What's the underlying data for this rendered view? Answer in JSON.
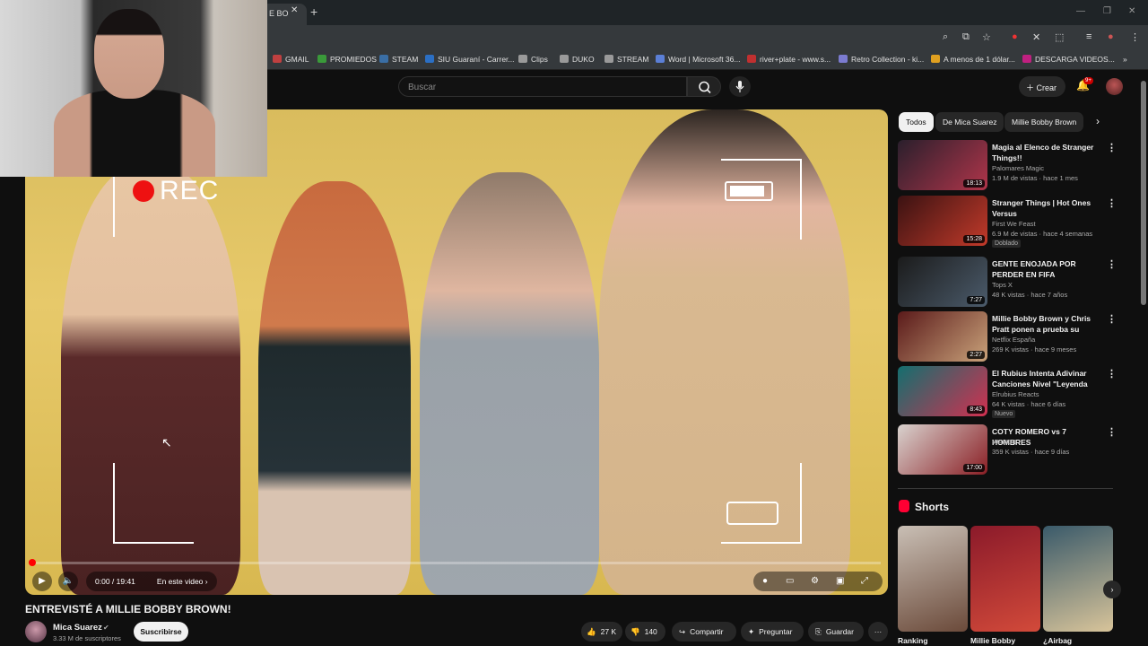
{
  "browser": {
    "tab_title": "E BO",
    "bookmarks": [
      {
        "label": "GMAIL",
        "color": "#c04040"
      },
      {
        "label": "PROMIEDOS",
        "color": "#3a9a3a"
      },
      {
        "label": "STEAM",
        "color": "#3a6ea5"
      },
      {
        "label": "SIU Guaraní - Carrer...",
        "color": "#2b6fc4"
      },
      {
        "label": "Clips",
        "color": "#9a9a9a"
      },
      {
        "label": "DUKO",
        "color": "#9a9a9a"
      },
      {
        "label": "STREAM",
        "color": "#9a9a9a"
      },
      {
        "label": "Word | Microsoft 36...",
        "color": "#5b7fd6"
      },
      {
        "label": "river+plate - www.s...",
        "color": "#c03030"
      },
      {
        "label": "Retro Collection - ki...",
        "color": "#7b7bd0"
      },
      {
        "label": "A menos de 1 dólar...",
        "color": "#e0a020"
      },
      {
        "label": "DESCARGA VIDEOS...",
        "color": "#c02080"
      }
    ]
  },
  "header": {
    "search_placeholder": "Buscar",
    "create_label": "Crear",
    "notif_count": "9+"
  },
  "player": {
    "overlay_rec": "REC",
    "time": "0:00 / 19:41",
    "chapter": "En este video ›",
    "progress": 0.0
  },
  "video": {
    "title": "ENTREVISTÉ A MILLIE BOBBY BROWN!",
    "channel": "Mica Suarez",
    "subscribers": "3.33 M de suscriptores",
    "subscribe_label": "Suscribirse",
    "likes": "27 K",
    "dislikes": "140",
    "share_label": "Compartir",
    "ask_label": "Preguntar",
    "save_label": "Guardar",
    "more_label": "···"
  },
  "sidebar": {
    "chips": [
      "Todos",
      "De Mica Suarez",
      "Millie Bobby Brown"
    ],
    "recs": [
      {
        "title": "Magia al Elenco de Stranger Things!!",
        "channel": "Palomares Magic",
        "meta": "1.9 M de vistas · hace 1 mes",
        "duration": "18:13",
        "badge": "",
        "colors": [
          "#2a1f2c",
          "#b0354a"
        ]
      },
      {
        "title": "Stranger Things | Hot Ones Versus",
        "channel": "First We Feast",
        "meta": "6.9 M de vistas · hace 4 semanas",
        "duration": "15:28",
        "badge": "Doblado",
        "colors": [
          "#3a1212",
          "#c23a2a"
        ]
      },
      {
        "title": "GENTE ENOJADA POR PERDER EN FIFA",
        "channel": "Tops X",
        "meta": "48 K vistas · hace 7 años",
        "duration": "7:27",
        "badge": "",
        "colors": [
          "#1b1b1b",
          "#4b5b6b"
        ]
      },
      {
        "title": "Millie Bobby Brown y Chris Pratt ponen a prueba su español | ...",
        "channel": "Netflix España",
        "meta": "269 K vistas · hace 9 meses",
        "duration": "2:27",
        "badge": "",
        "colors": [
          "#5a1a1a",
          "#c9a27a"
        ]
      },
      {
        "title": "El Rubius Intenta Adivinar Canciones Nivel \"Leyenda del ...",
        "channel": "Elrubius Reacts",
        "meta": "64 K vistas · hace 6 días",
        "duration": "8:43",
        "badge": "Nuevo",
        "colors": [
          "#136f6f",
          "#d23050"
        ]
      },
      {
        "title": "COTY ROMERO vs 7 HOMBRES",
        "channel": "WANDII",
        "meta": "359 K vistas · hace 9 días",
        "duration": "17:00",
        "badge": "",
        "colors": [
          "#d9d3cf",
          "#8a1e24"
        ]
      }
    ],
    "shorts_title": "Shorts",
    "shorts": [
      {
        "label": "Ranking",
        "colors": [
          "#c9bfb5",
          "#6b4a3a"
        ]
      },
      {
        "label": "Millie Bobby",
        "colors": [
          "#8b1a2a",
          "#d24a3a"
        ]
      },
      {
        "label": "¿Airbag",
        "colors": [
          "#3a5a6a",
          "#d8c49a"
        ]
      }
    ]
  }
}
